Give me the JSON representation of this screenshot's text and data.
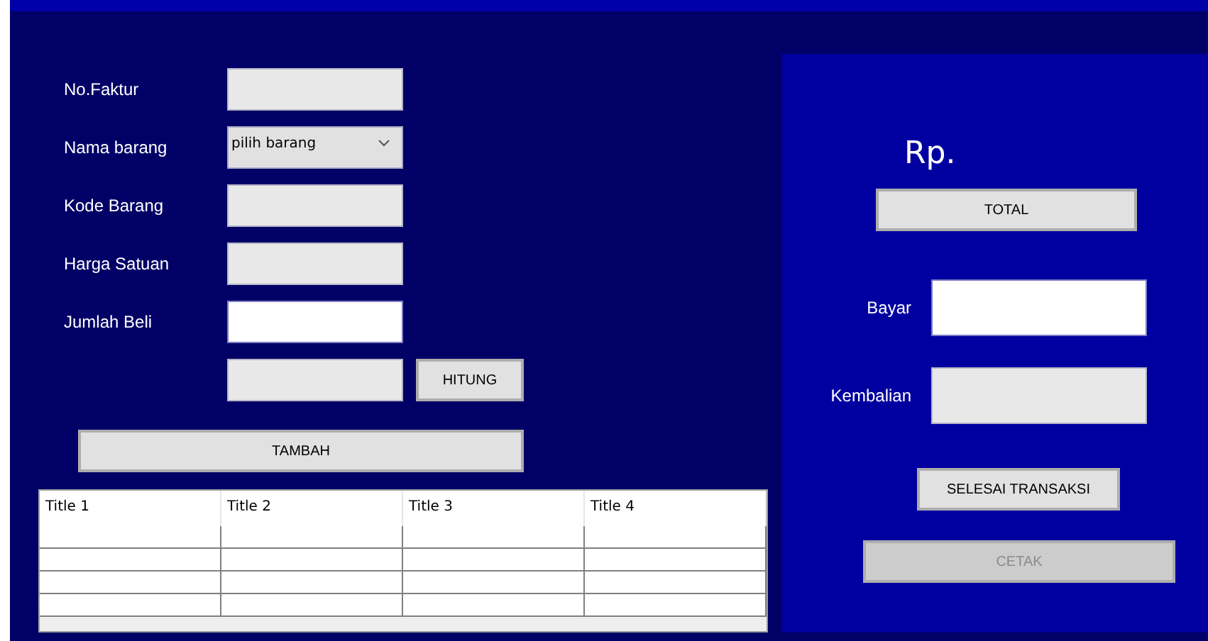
{
  "form": {
    "fields": [
      {
        "label": "No.Faktur",
        "kind": "text",
        "editable": false
      },
      {
        "label": "Nama barang",
        "kind": "combo",
        "value": "pilih barang"
      },
      {
        "label": "Kode Barang",
        "kind": "text",
        "editable": false
      },
      {
        "label": "Harga Satuan",
        "kind": "text",
        "editable": false
      },
      {
        "label": "Jumlah Beli",
        "kind": "text",
        "editable": true
      },
      {
        "kind": "text",
        "editable": false,
        "button": {
          "label": "HITUNG",
          "disabled": false
        }
      }
    ],
    "add_button": {
      "label": "TAMBAH",
      "disabled": false
    }
  },
  "table": {
    "columns": [
      "Title 1",
      "Title 2",
      "Title 3",
      "Title 4"
    ]
  },
  "payment": {
    "currency": "Rp.",
    "total_button": {
      "label": "TOTAL",
      "disabled": false
    },
    "fields": [
      {
        "label": "Bayar",
        "editable": true
      },
      {
        "label": "Kembalian",
        "editable": false
      }
    ],
    "finish_button": {
      "label": "SELESAI TRANSAKSI",
      "disabled": false
    },
    "print_button": {
      "label": "CETAK",
      "disabled": true
    }
  }
}
